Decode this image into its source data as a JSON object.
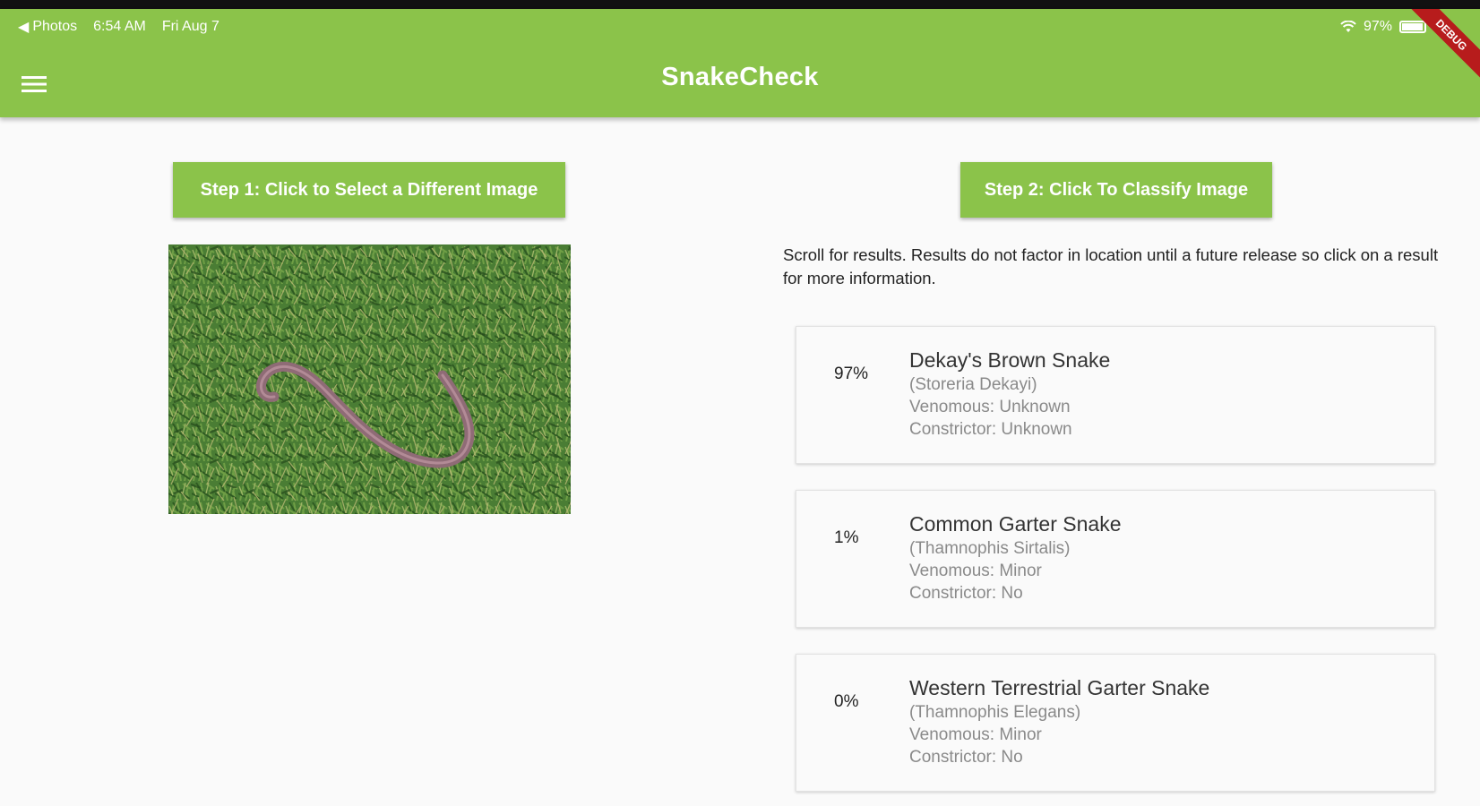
{
  "status_bar": {
    "back_label": "Photos",
    "time": "6:54 AM",
    "date": "Fri Aug 7",
    "battery": "97%",
    "battery_level": 0.97
  },
  "app_bar": {
    "title": "SnakeCheck",
    "debug_label": "DEBUG",
    "color": "#8bc34a"
  },
  "actions": {
    "select_image_label": "Step 1: Click to Select a Different Image",
    "classify_label": "Step 2: Click To Classify Image"
  },
  "hint_text": "Scroll for results.  Results do not factor in location until a future release so click on a result for more information.",
  "results": [
    {
      "percent": "97%",
      "name": "Dekay's Brown Snake",
      "scientific": "(Storeria Dekayi)",
      "venomous": "Venomous: Unknown",
      "constrictor": "Constrictor: Unknown"
    },
    {
      "percent": "1%",
      "name": "Common Garter Snake",
      "scientific": "(Thamnophis Sirtalis)",
      "venomous": "Venomous: Minor",
      "constrictor": "Constrictor: No"
    },
    {
      "percent": "0%",
      "name": "Western Terrestrial Garter Snake",
      "scientific": "(Thamnophis Elegans)",
      "venomous": "Venomous: Minor",
      "constrictor": "Constrictor: No"
    }
  ]
}
